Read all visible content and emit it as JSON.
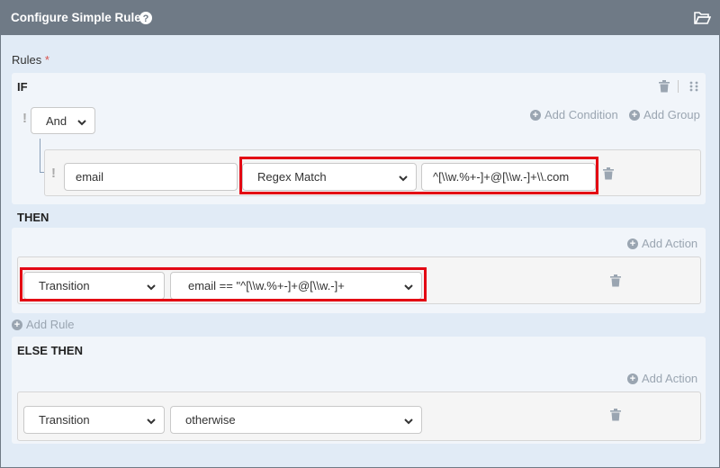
{
  "header": {
    "title": "Configure Simple Rules"
  },
  "rules_label": "Rules",
  "required_mark": "*",
  "if_section": {
    "title": "IF",
    "operator": "And",
    "add_condition": "Add Condition",
    "add_group": "Add Group",
    "condition": {
      "field": "email",
      "comparison": "Regex Match",
      "value": "^[\\\\w.%+-]+@[\\\\w.-]+\\\\.com"
    }
  },
  "then_section": {
    "title": "THEN",
    "add_action": "Add Action",
    "action": {
      "type": "Transition",
      "target": "email == \"^[\\\\w.%+-]+@[\\\\w.-]+"
    }
  },
  "add_rule": "Add Rule",
  "else_section": {
    "title": "ELSE THEN",
    "add_action": "Add Action",
    "action": {
      "type": "Transition",
      "target": "otherwise"
    }
  },
  "colors": {
    "header_bg": "#6f7a86",
    "panel_bg": "#e1ebf6",
    "highlight": "#e30613",
    "link_gray": "#9aa5b1"
  }
}
